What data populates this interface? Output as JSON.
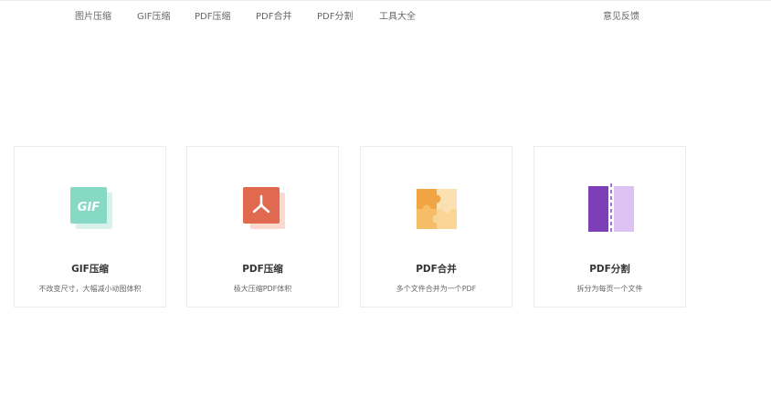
{
  "nav": {
    "items": [
      {
        "label": "图片压缩"
      },
      {
        "label": "GIF压缩"
      },
      {
        "label": "PDF压缩"
      },
      {
        "label": "PDF合并"
      },
      {
        "label": "PDF分割"
      },
      {
        "label": "工具大全"
      }
    ],
    "feedback_label": "意见反馈"
  },
  "cards": [
    {
      "title": "GIF压缩",
      "desc": "不改变尺寸，大幅减小动图体积",
      "icon": "gif-icon",
      "icon_text": "GIF",
      "color": "#86d9c4",
      "color_light": "#d8f1ea"
    },
    {
      "title": "PDF压缩",
      "desc": "极大压缩PDF体积",
      "icon": "pdf-icon",
      "color": "#e06950",
      "color_light": "#fbd9cd"
    },
    {
      "title": "PDF合并",
      "desc": "多个文件合并为一个PDF",
      "icon": "puzzle-icon",
      "color": "#f0a444",
      "color_light": "#fbe0b2"
    },
    {
      "title": "PDF分割",
      "desc": "拆分为每页一个文件",
      "icon": "split-icon",
      "color": "#7d3fb8",
      "color_light": "#dcc2f3"
    }
  ]
}
